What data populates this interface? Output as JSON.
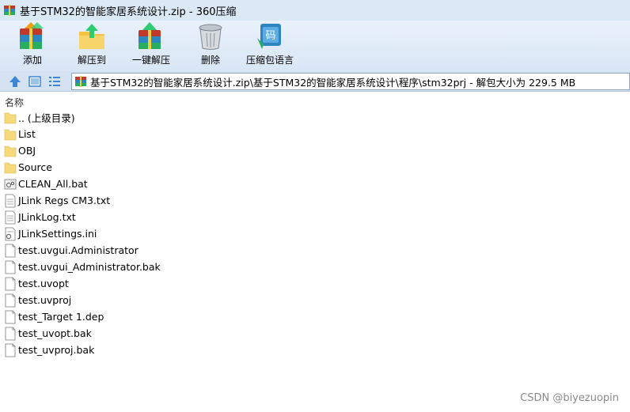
{
  "window": {
    "title": "基于STM32的智能家居系统设计.zip - 360压缩"
  },
  "toolbar": {
    "buttons": [
      {
        "label": "添加",
        "icon": "add-archive-icon"
      },
      {
        "label": "解压到",
        "icon": "extract-to-icon"
      },
      {
        "label": "一键解压",
        "icon": "one-click-extract-icon"
      },
      {
        "label": "删除",
        "icon": "trash-icon"
      },
      {
        "label": "压缩包语言",
        "icon": "archive-language-icon"
      }
    ]
  },
  "addressbar": {
    "path": "基于STM32的智能家居系统设计.zip\\基于STM32的智能家居系统设计\\程序\\stm32prj - 解包大小为 229.5 MB"
  },
  "list": {
    "column_name": "名称",
    "items": [
      {
        "name": ".. (上级目录)",
        "type": "folder"
      },
      {
        "name": "List",
        "type": "folder"
      },
      {
        "name": "OBJ",
        "type": "folder"
      },
      {
        "name": "Source",
        "type": "folder"
      },
      {
        "name": "CLEAN_All.bat",
        "type": "bat"
      },
      {
        "name": "JLink Regs CM3.txt",
        "type": "txt"
      },
      {
        "name": "JLinkLog.txt",
        "type": "txt"
      },
      {
        "name": "JLinkSettings.ini",
        "type": "ini"
      },
      {
        "name": "test.uvgui.Administrator",
        "type": "file"
      },
      {
        "name": "test.uvgui_Administrator.bak",
        "type": "file"
      },
      {
        "name": "test.uvopt",
        "type": "file"
      },
      {
        "name": "test.uvproj",
        "type": "file"
      },
      {
        "name": "test_Target 1.dep",
        "type": "file"
      },
      {
        "name": "test_uvopt.bak",
        "type": "file"
      },
      {
        "name": "test_uvproj.bak",
        "type": "file"
      }
    ]
  },
  "watermark": "CSDN @biyezuopin",
  "colors": {
    "titlebar": "#dbe8f5",
    "toolbar": "#e2ecf8",
    "folder": "#f5d97a",
    "nav_blue": "#3d86d6"
  }
}
